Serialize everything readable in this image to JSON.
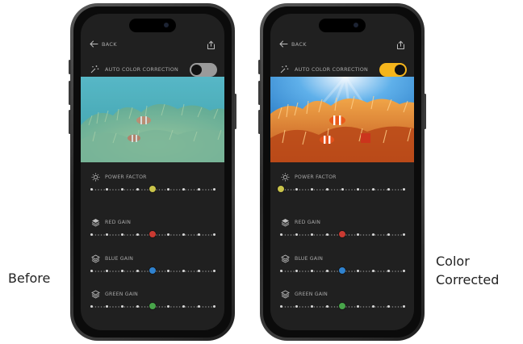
{
  "captions": {
    "before": "Before",
    "after_line1": "Color",
    "after_line2": "Corrected"
  },
  "phones": [
    {
      "id": "before",
      "back_label": "BACK",
      "auto_color_label": "AUTO COLOR CORRECTION",
      "auto_color_on": false,
      "controls": [
        {
          "label": "POWER FACTOR",
          "icon": "sun-icon",
          "color": "#c9c34a",
          "level": 0.5
        },
        {
          "label": "RED GAIN",
          "icon": "layers-icon",
          "color": "#c93a32",
          "level": 0.5
        },
        {
          "label": "BLUE GAIN",
          "icon": "layers-icon",
          "color": "#2f82cf",
          "level": 0.5
        },
        {
          "label": "GREEN GAIN",
          "icon": "layers-icon",
          "color": "#48a44a",
          "level": 0.5
        }
      ]
    },
    {
      "id": "after",
      "back_label": "BACK",
      "auto_color_label": "AUTO COLOR CORRECTION",
      "auto_color_on": true,
      "controls": [
        {
          "label": "POWER FACTOR",
          "icon": "sun-icon",
          "color": "#c9c34a",
          "level": 0.0
        },
        {
          "label": "RED GAIN",
          "icon": "layers-icon",
          "color": "#c93a32",
          "level": 0.5
        },
        {
          "label": "BLUE GAIN",
          "icon": "layers-icon",
          "color": "#2f82cf",
          "level": 0.5
        },
        {
          "label": "GREEN GAIN",
          "icon": "layers-icon",
          "color": "#48a44a",
          "level": 0.5
        }
      ]
    }
  ],
  "colors": {
    "toggle_on": "#f5b51c",
    "toggle_off": "#9a9a9a",
    "screen_bg": "#202020"
  }
}
